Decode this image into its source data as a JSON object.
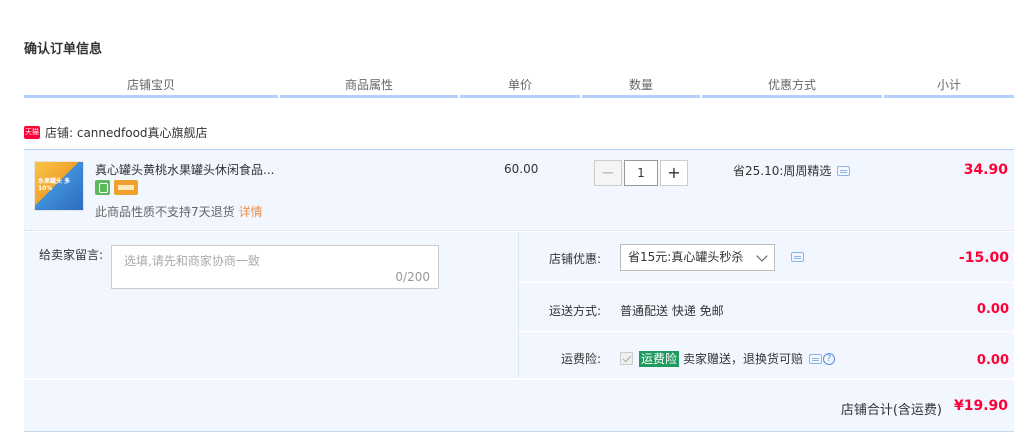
{
  "page": {
    "title": "确认订单信息"
  },
  "columns": [
    "店铺宝贝",
    "商品属性",
    "单价",
    "数量",
    "优惠方式",
    "小计"
  ],
  "shop": {
    "badge_text": "天猫",
    "label": "店铺: cannedfood真心旗舰店"
  },
  "item": {
    "title": "真心罐头黄桃水果罐头休闲食品...",
    "thumb_text": "水果罐头 多10%",
    "return_note": "此商品性质不支持7天退货",
    "detail_link": "详情",
    "unit_price": "60.00",
    "quantity": "1",
    "minus_label": "−",
    "plus_label": "+",
    "promo": "省25.10:周周精选",
    "subtotal": "34.90"
  },
  "message": {
    "label": "给卖家留言:",
    "placeholder": "选填,请先和商家协商一致",
    "count": "0/200"
  },
  "shop_discount": {
    "label": "店铺优惠:",
    "selected": "省15元:真心罐头秒杀",
    "value": "-15.00"
  },
  "shipping": {
    "label": "运送方式:",
    "text": "普通配送 快递 免邮",
    "value": "0.00"
  },
  "insurance": {
    "label": "运费险:",
    "tag": "运费险",
    "text": "卖家赠送，退换货可赔",
    "help": "?",
    "value": "0.00"
  },
  "total": {
    "label": "店铺合计(含运费)",
    "value": "¥19.90"
  },
  "colors": {
    "accent_red": "#ff0036",
    "row_bg": "#f2f7ff",
    "header_line": "#b2d1ff",
    "ins_green": "#1e9a5e"
  }
}
